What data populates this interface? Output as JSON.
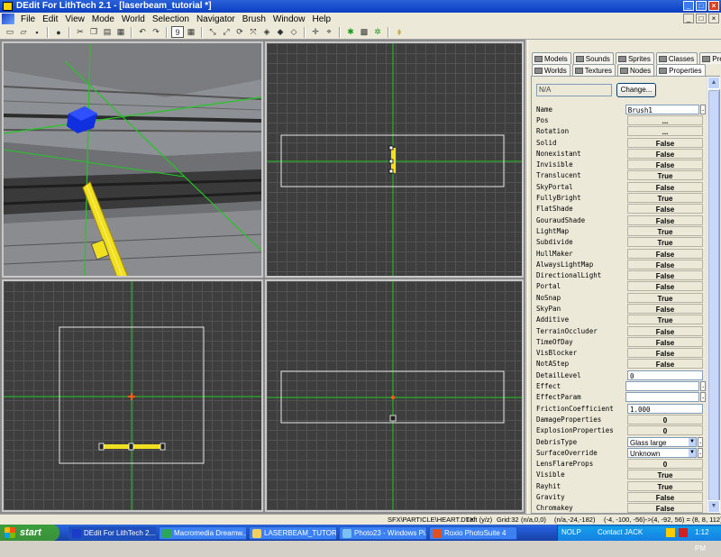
{
  "window": {
    "title": "DEdit For LithTech 2.1 - [laserbeam_tutorial *]",
    "min": "_",
    "max": "□",
    "close": "×"
  },
  "menubar": {
    "items": [
      "File",
      "Edit",
      "View",
      "Mode",
      "World",
      "Selection",
      "Navigator",
      "Brush",
      "Window",
      "Help"
    ]
  },
  "toolbar": {
    "grid_value": "9"
  },
  "panel": {
    "tabs_row1": [
      "Models",
      "Sounds",
      "Sprites",
      "Classes",
      "Prefabs"
    ],
    "tabs_row2": [
      "Worlds",
      "Textures",
      "Nodes",
      "Properties"
    ],
    "active_tab": "Properties",
    "class_field": "N/A",
    "change_button": "Change...",
    "properties": [
      {
        "name": "Name",
        "value": "Brush1",
        "kind": "input",
        "btn": "."
      },
      {
        "name": "Pos",
        "value": "...",
        "kind": "button"
      },
      {
        "name": "Rotation",
        "value": "...",
        "kind": "button"
      },
      {
        "name": "Solid",
        "value": "False",
        "kind": "bool"
      },
      {
        "name": "Nonexistant",
        "value": "False",
        "kind": "bool"
      },
      {
        "name": "Invisible",
        "value": "False",
        "kind": "bool"
      },
      {
        "name": "Translucent",
        "value": "True",
        "kind": "bool"
      },
      {
        "name": "SkyPortal",
        "value": "False",
        "kind": "bool"
      },
      {
        "name": "FullyBright",
        "value": "True",
        "kind": "bool"
      },
      {
        "name": "FlatShade",
        "value": "False",
        "kind": "bool"
      },
      {
        "name": "GouraudShade",
        "value": "False",
        "kind": "bool"
      },
      {
        "name": "LightMap",
        "value": "True",
        "kind": "bool"
      },
      {
        "name": "Subdivide",
        "value": "True",
        "kind": "bool"
      },
      {
        "name": "HullMaker",
        "value": "False",
        "kind": "bool"
      },
      {
        "name": "AlwaysLightMap",
        "value": "False",
        "kind": "bool"
      },
      {
        "name": "DirectionalLight",
        "value": "False",
        "kind": "bool"
      },
      {
        "name": "Portal",
        "value": "False",
        "kind": "bool"
      },
      {
        "name": "NoSnap",
        "value": "True",
        "kind": "bool"
      },
      {
        "name": "SkyPan",
        "value": "False",
        "kind": "bool"
      },
      {
        "name": "Additive",
        "value": "True",
        "kind": "bool"
      },
      {
        "name": "TerrainOccluder",
        "value": "False",
        "kind": "bool"
      },
      {
        "name": "TimeOfDay",
        "value": "False",
        "kind": "bool"
      },
      {
        "name": "VisBlocker",
        "value": "False",
        "kind": "bool"
      },
      {
        "name": "NotAStep",
        "value": "False",
        "kind": "bool"
      },
      {
        "name": "DetailLevel",
        "value": "0",
        "kind": "input"
      },
      {
        "name": "Effect",
        "value": "",
        "kind": "input",
        "btn": "."
      },
      {
        "name": "EffectParam",
        "value": "",
        "kind": "input",
        "btn": "."
      },
      {
        "name": "FrictionCoefficient",
        "value": "1.000",
        "kind": "input"
      },
      {
        "name": "DamageProperties",
        "value": "0",
        "kind": "bool"
      },
      {
        "name": "ExplosionProperties",
        "value": "0",
        "kind": "bool"
      },
      {
        "name": "DebrisType",
        "value": "Glass large",
        "kind": "combo",
        "btn": "."
      },
      {
        "name": "SurfaceOverride",
        "value": "Unknown",
        "kind": "combo",
        "btn": "."
      },
      {
        "name": "LensFlareProps",
        "value": "0",
        "kind": "bool"
      },
      {
        "name": "Visible",
        "value": "True",
        "kind": "bool"
      },
      {
        "name": "Rayhit",
        "value": "True",
        "kind": "bool"
      },
      {
        "name": "Gravity",
        "value": "False",
        "kind": "bool"
      },
      {
        "name": "Chromakey",
        "value": "False",
        "kind": "bool"
      }
    ]
  },
  "status": {
    "object": "SFX\\PARTICLE\\HEART.DTX",
    "view": "Left (y/z)",
    "grid": "Grid:32",
    "coord1": "(n/a,0,0)",
    "coord2": "(n/a,-24,-182)",
    "coord3": "(-4, -100, -56)->(4, -92, 56) = (8, 8, 112)"
  },
  "taskbar": {
    "start": "start",
    "tasks": [
      "DEdit For LithTech 2....",
      "Macromedia Dreamw...",
      "LASERBEAM_TUTORIAL",
      "Photo23 - Windows Pi...",
      "Roxio PhotoSuite 4"
    ],
    "tray_nolp": "NOLP",
    "tray_contact": "Contact JACK",
    "clock": "1:12 PM"
  },
  "colors": {
    "axis_green": "#22c822",
    "brush_yellow": "#f0e020",
    "selection_blue": "#1030e0",
    "origin_orange": "#ff6010",
    "xp_blue": "#245edb"
  }
}
